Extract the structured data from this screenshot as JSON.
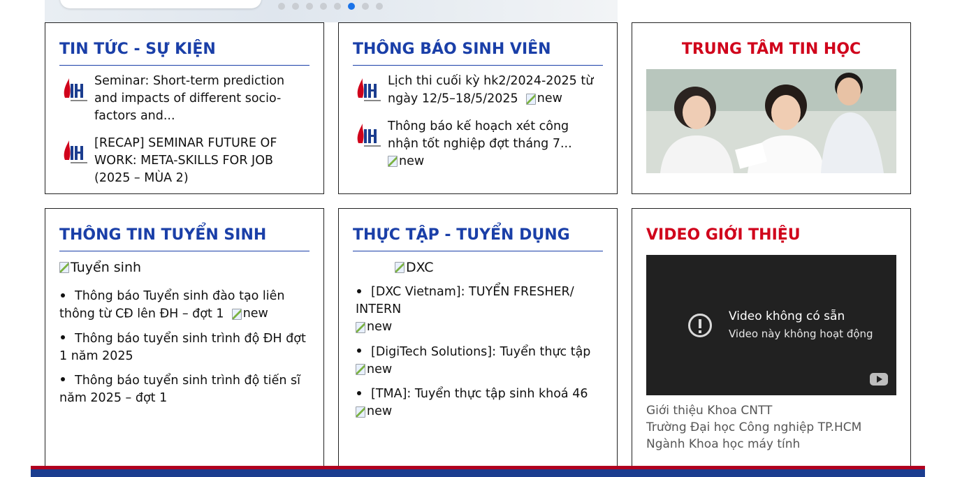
{
  "banner": {
    "slides": 8,
    "active_index": 5
  },
  "news": {
    "title": "TIN TỨC - SỰ KIỆN",
    "items": [
      {
        "text": "Seminar: Short-term prediction and impacts of different socio-factors and..."
      },
      {
        "text": "[RECAP] SEMINAR FUTURE OF WORK: META-SKILLS FOR JOB (2025 – MÙA 2)"
      }
    ]
  },
  "student_notices": {
    "title": "THÔNG BÁO SINH VIÊN",
    "items": [
      {
        "text": "Lịch thi cuối kỳ hk2/2024-2025 từ ngày 12/5–18/5/2025",
        "badge_alt": "new"
      },
      {
        "text": "Thông báo kế hoạch xét công nhận tốt nghiệp đợt tháng 7...",
        "badge_alt": "new"
      }
    ]
  },
  "it_center": {
    "title": "TRUNG TÂM TIN HỌC"
  },
  "admissions": {
    "title": "THÔNG TIN TUYỂN SINH",
    "image_alt": "Tuyển sinh",
    "items": [
      {
        "text": "Thông báo Tuyển sinh đào tạo liên thông từ CĐ lên ĐH – đợt 1",
        "badge_alt": "new"
      },
      {
        "text": "Thông báo tuyển sinh trình độ ĐH đợt 1 năm 2025"
      },
      {
        "text": "Thông báo tuyển sinh trình độ tiến sĩ năm 2025 – đợt 1"
      }
    ]
  },
  "internship": {
    "title": "THỰC TẬP - TUYỂN DỤNG",
    "image_alt": "DXC",
    "items": [
      {
        "text": "[DXC Vietnam]: TUYỂN FRESHER/ INTERN",
        "badge_alt": "new"
      },
      {
        "text": "[DigiTech Solutions]: Tuyển thực tập",
        "badge_alt": "new"
      },
      {
        "text": "[TMA]: Tuyển thực tập sinh khoá 46",
        "badge_alt": "new"
      }
    ]
  },
  "video": {
    "title": "VIDEO GIỚI THIỆU",
    "unavailable_title": "Video không có sẵn",
    "unavailable_sub": "Video này không hoạt động",
    "lines": [
      "Giới thiệu Khoa CNTT",
      "Trường Đại học Công nghiệp TP.HCM",
      "Ngành Khoa học máy tính"
    ]
  },
  "colors": {
    "heading_blue": "#1a3fa8",
    "heading_red": "#d0021b",
    "footer_red": "#b00020",
    "footer_blue": "#1b3d8f"
  }
}
